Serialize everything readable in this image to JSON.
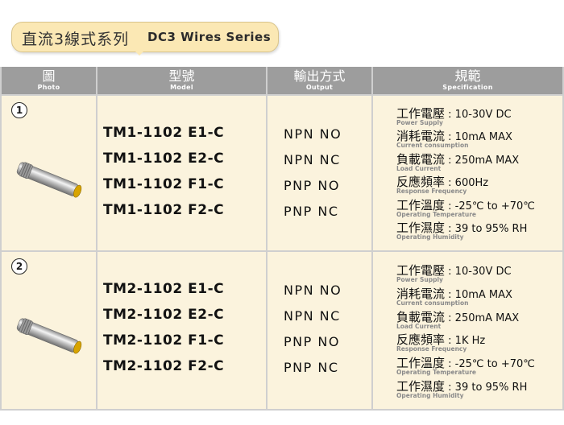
{
  "title": {
    "zh": "直流3線式系列",
    "en": "DC3 Wires Series"
  },
  "headers": [
    {
      "zh": "圖",
      "en": "Photo"
    },
    {
      "zh": "型號",
      "en": "Model"
    },
    {
      "zh": "輸出方式",
      "en": "Output"
    },
    {
      "zh": "規範",
      "en": "Specification"
    }
  ],
  "groups": [
    {
      "num": "1",
      "models": [
        "TM1-1102 E1-C",
        "TM1-1102 E2-C",
        "TM1-1102 F1-C",
        "TM1-1102 F2-C"
      ],
      "outputs": [
        "NPN NO",
        "NPN NC",
        "PNP NO",
        "PNP NC"
      ],
      "specs": [
        {
          "label": "工作電壓",
          "sep": " : ",
          "value": "10-30V DC",
          "sub": "Power Supply"
        },
        {
          "label": "消耗電流",
          "sep": " : ",
          "value": "10mA MAX",
          "sub": "Current consumption"
        },
        {
          "label": "負載電流",
          "sep": " : ",
          "value": "250mA MAX",
          "sub": "Load Current"
        },
        {
          "label": "反應頻率",
          "sep": " : ",
          "value": "600Hz",
          "sub": "Response Frequency"
        },
        {
          "label": "工作溫度",
          "sep": " : ",
          "value": "-25℃ to +70℃",
          "sub": "Operating Temperature"
        },
        {
          "label": "工作濕度",
          "sep": " : ",
          "value": "39 to 95% RH",
          "sub": "Operating Humidity"
        }
      ]
    },
    {
      "num": "2",
      "models": [
        "TM2-1102 E1-C",
        "TM2-1102 E2-C",
        "TM2-1102 F1-C",
        "TM2-1102 F2-C"
      ],
      "outputs": [
        "NPN NO",
        "NPN NC",
        "PNP NO",
        "PNP NC"
      ],
      "specs": [
        {
          "label": "工作電壓",
          "sep": " : ",
          "value": "10-30V DC",
          "sub": "Power Supply"
        },
        {
          "label": "消耗電流",
          "sep": " : ",
          "value": "10mA MAX",
          "sub": "Current consumption"
        },
        {
          "label": "負載電流",
          "sep": " : ",
          "value": "250mA MAX",
          "sub": "Load Current"
        },
        {
          "label": "反應頻率",
          "sep": " : ",
          "value": "1K Hz",
          "sub": "Response Frequency"
        },
        {
          "label": "工作溫度",
          "sep": " : ",
          "value": "-25℃ to +70℃",
          "sub": "Operating Temperature"
        },
        {
          "label": "工作濕度",
          "sep": " : ",
          "value": "39 to 95% RH",
          "sub": "Operating Humidity"
        }
      ]
    }
  ]
}
